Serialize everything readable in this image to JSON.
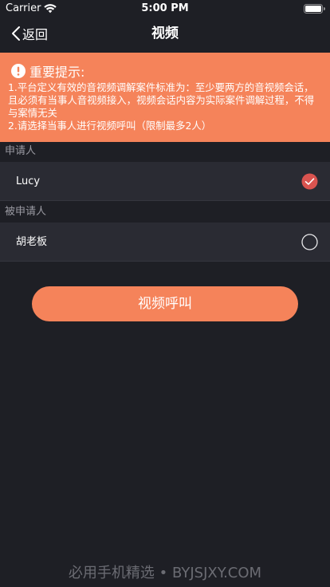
{
  "status_bar": {
    "carrier": "Carrier",
    "time": "5:00 PM",
    "icons": [
      "wifi-icon",
      "battery-icon"
    ]
  },
  "nav": {
    "back_label": "返回",
    "title": "视频"
  },
  "notice": {
    "title": "重要提示:",
    "lines": [
      "1.平台定义有效的音视频调解案件标准为：至少要两方的音视频会话，且必须有当事人音视频接入，视频会话内容为实际案件调解过程，不得与案情无关",
      "2.请选择当事人进行视频呼叫（限制最多2人）"
    ],
    "icon": "exclamation-circle-icon"
  },
  "applicant": {
    "header": "申请人",
    "name": "Lucy",
    "selected": true
  },
  "respondent": {
    "header": "被申请人",
    "name": "胡老板",
    "selected": false
  },
  "call_button_label": "视频呼叫",
  "watermark": "必用手机精选 • BYJSJXY.COM",
  "colors": {
    "background": "#1e1f25",
    "row_background": "#2a2b33",
    "accent": "#f5835a",
    "check_selected": "#d9534f"
  }
}
